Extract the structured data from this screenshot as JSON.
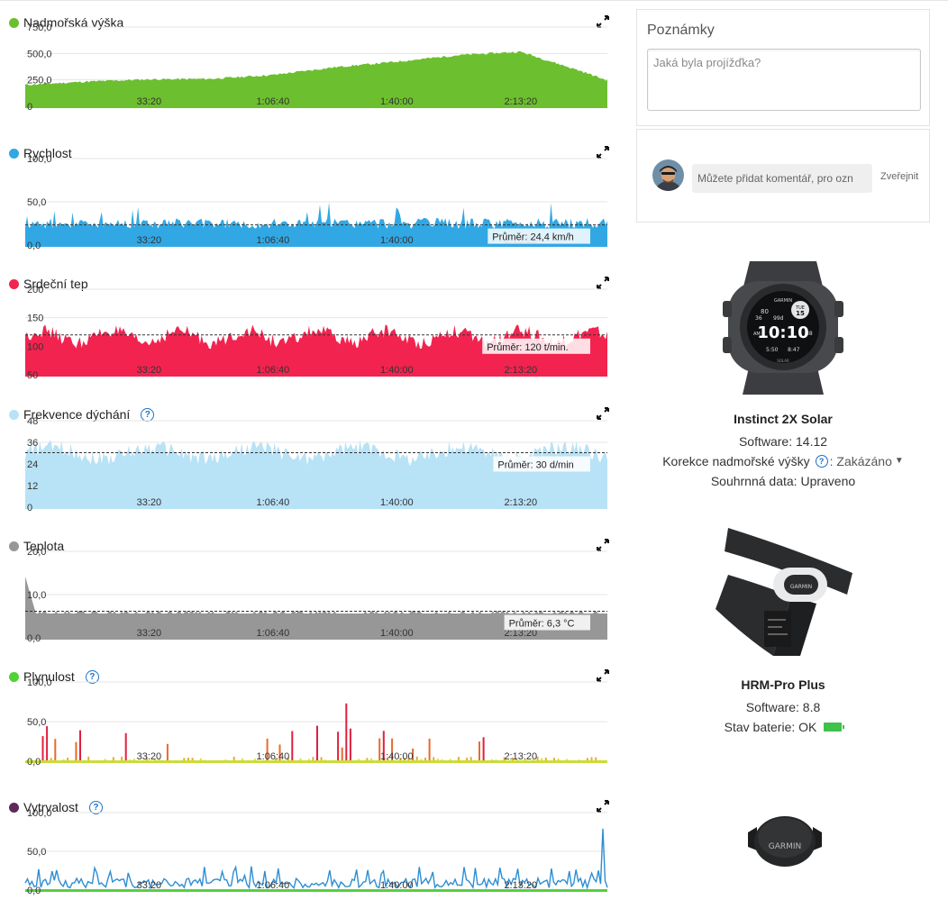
{
  "colors": {
    "altitude": "#6cbf2f",
    "speed": "#31a8e4",
    "heart_rate": "#f2234f",
    "respiration": "#b8e2f6",
    "temperature": "#979797",
    "flow": "#4fd334",
    "grit": "#5b2a5b",
    "help": "#1a73c7",
    "battery_ok": "#3fc14a"
  },
  "x_axis_ticks": [
    "33:20",
    "1:06:40",
    "1:40:00",
    "2:13:20"
  ],
  "charts": [
    {
      "id": "altitude",
      "title": "Nadmořská výška",
      "has_help": false,
      "y_ticks": [
        "750,0",
        "500,0",
        "250,0",
        "0"
      ],
      "avg_label": ""
    },
    {
      "id": "speed",
      "title": "Rychlost",
      "has_help": false,
      "y_ticks": [
        "100,0",
        "50,0",
        "0,0"
      ],
      "avg_label": "Průměr: 24,4 km/h"
    },
    {
      "id": "heart_rate",
      "title": "Srdeční tep",
      "has_help": false,
      "y_ticks": [
        "200",
        "150",
        "100",
        "50"
      ],
      "avg_label": "Průměr: 120 t/min."
    },
    {
      "id": "respiration",
      "title": "Frekvence dýchání",
      "has_help": true,
      "y_ticks": [
        "48",
        "36",
        "24",
        "12",
        "0"
      ],
      "avg_label": "Průměr: 30 d/min"
    },
    {
      "id": "temperature",
      "title": "Teplota",
      "has_help": false,
      "y_ticks": [
        "20,0",
        "10,0",
        "0,0"
      ],
      "avg_label": "Průměr: 6,3 °C"
    },
    {
      "id": "flow",
      "title": "Plynulost",
      "has_help": true,
      "y_ticks": [
        "100,0",
        "50,0",
        "0,0"
      ],
      "avg_label": ""
    },
    {
      "id": "grit",
      "title": "Vytrvalost",
      "has_help": true,
      "y_ticks": [
        "100,0",
        "50,0",
        "0,0"
      ],
      "avg_label": ""
    }
  ],
  "chart_data": [
    {
      "type": "area",
      "title": "Nadmořská výška",
      "ylim": [
        0,
        750
      ],
      "x_tick_labels": [
        "33:20",
        "1:06:40",
        "1:40:00",
        "2:13:20"
      ],
      "x_seconds": [
        0,
        1000,
        2000,
        3000,
        4000,
        5000,
        6000,
        7000,
        8000,
        9000,
        9400
      ],
      "values": [
        210,
        240,
        260,
        265,
        300,
        370,
        420,
        480,
        510,
        330,
        250
      ]
    },
    {
      "type": "area",
      "title": "Rychlost",
      "ylim": [
        0,
        100
      ],
      "x_tick_labels": [
        "33:20",
        "1:06:40",
        "1:40:00",
        "2:13:20"
      ],
      "average": 24.4,
      "avg_label": "Průměr: 24,4 km/h"
    },
    {
      "type": "area",
      "title": "Srdeční tep",
      "ylim": [
        50,
        200
      ],
      "x_tick_labels": [
        "33:20",
        "1:06:40",
        "1:40:00",
        "2:13:20"
      ],
      "average": 120,
      "avg_label": "Průměr: 120 t/min."
    },
    {
      "type": "area",
      "title": "Frekvence dýchání",
      "ylim": [
        0,
        48
      ],
      "x_tick_labels": [
        "33:20",
        "1:06:40",
        "1:40:00",
        "2:13:20"
      ],
      "average": 30,
      "avg_label": "Průměr: 30 d/min"
    },
    {
      "type": "area",
      "title": "Teplota",
      "ylim": [
        0,
        20
      ],
      "x_tick_labels": [
        "33:20",
        "1:06:40",
        "1:40:00",
        "2:13:20"
      ],
      "average": 6.3,
      "avg_label": "Průměr: 6,3 °C"
    },
    {
      "type": "bar",
      "title": "Plynulost",
      "ylim": [
        0,
        100
      ],
      "x_tick_labels": [
        "33:20",
        "1:06:40",
        "1:40:00",
        "2:13:20"
      ]
    },
    {
      "type": "line",
      "title": "Vytrvalost",
      "ylim": [
        0,
        100
      ],
      "x_tick_labels": [
        "33:20",
        "1:06:40",
        "1:40:00",
        "2:13:20"
      ]
    }
  ],
  "notes": {
    "title": "Poznámky",
    "placeholder": "Jaká byla projížďka?"
  },
  "comment": {
    "placeholder": "Můžete přidat komentář, pro ozn",
    "publish_label": "Zveřejnit"
  },
  "devices": {
    "watch": {
      "name": "Instinct 2X Solar",
      "software": "Software: 14.12",
      "altitude_label": "Korekce nadmořské výšky",
      "altitude_value": ": Zakázáno",
      "summary": "Souhrnná data: Upraveno",
      "face_time": "10:10",
      "face_date_day": "TUE",
      "face_date_num": "15",
      "face_hr": "80",
      "face_steps": "36",
      "face_batt": "99d",
      "face_bottom_left": "5:50",
      "face_bottom_right": "8:47",
      "face_am": "AM",
      "face_sec": "38",
      "face_brand": "GARMIN",
      "face_solar": "SOLAR"
    },
    "hrm": {
      "name": "HRM-Pro Plus",
      "software": "Software: 8.8",
      "battery": "Stav baterie: OK",
      "brand": "GARMIN"
    },
    "sensor": {
      "brand": "GARMIN"
    }
  }
}
